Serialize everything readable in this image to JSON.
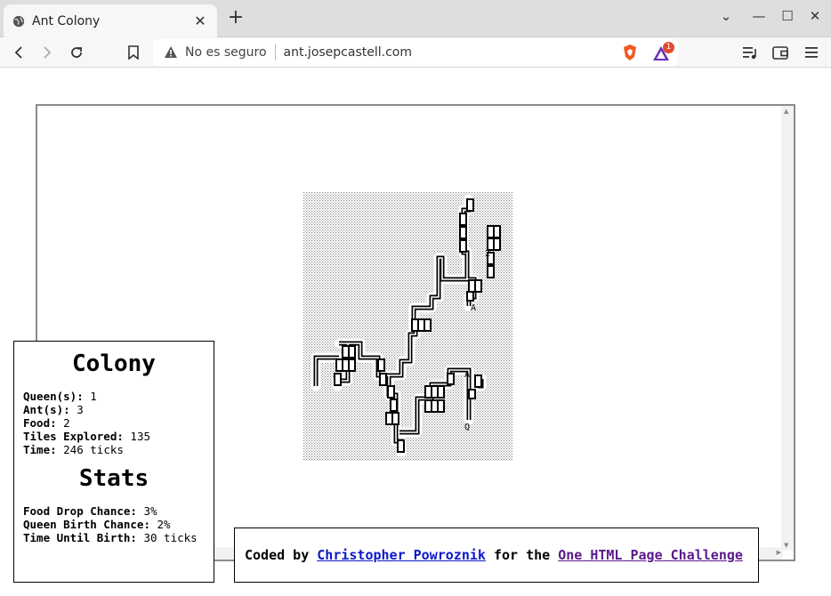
{
  "browser": {
    "tab_title": "Ant Colony",
    "tab_close": "✕",
    "new_tab": "+",
    "window_controls": [
      "⌄",
      "—",
      "☐",
      "✕"
    ],
    "insecure_label": "No es seguro",
    "url": "ant.josepcastell.com",
    "notification_count": "1",
    "icons": [
      "globe-icon",
      "back-icon",
      "forward-icon",
      "reload-icon",
      "bookmark-icon",
      "warning-icon",
      "brave-shield-icon",
      "brave-rewards-icon",
      "media-icon",
      "wallet-icon",
      "menu-icon"
    ]
  },
  "map": {
    "labels": [
      "2",
      "A",
      "A",
      "Q"
    ],
    "colors": {
      "dirt": "#a6a6a6",
      "tunnel": "#ffffff",
      "wall": "#000000"
    }
  },
  "colony_panel": {
    "title": "Colony",
    "rows": [
      {
        "label": "Queen(s):",
        "value": "1"
      },
      {
        "label": "Ant(s):",
        "value": "3"
      },
      {
        "label": "Food:",
        "value": "2"
      },
      {
        "label": "Tiles Explored:",
        "value": "135"
      },
      {
        "label": "Time:",
        "value": "246 ticks"
      }
    ]
  },
  "stats_panel": {
    "title": "Stats",
    "rows": [
      {
        "label": "Food Drop Chance:",
        "value": "3%"
      },
      {
        "label": "Queen Birth Chance:",
        "value": "2%"
      },
      {
        "label": "Time Until Birth:",
        "value": "30 ticks"
      }
    ]
  },
  "credits": {
    "prefix": "Coded by",
    "author": "Christopher Powroznik",
    "middle": "for the",
    "challenge": "One HTML Page Challenge"
  }
}
